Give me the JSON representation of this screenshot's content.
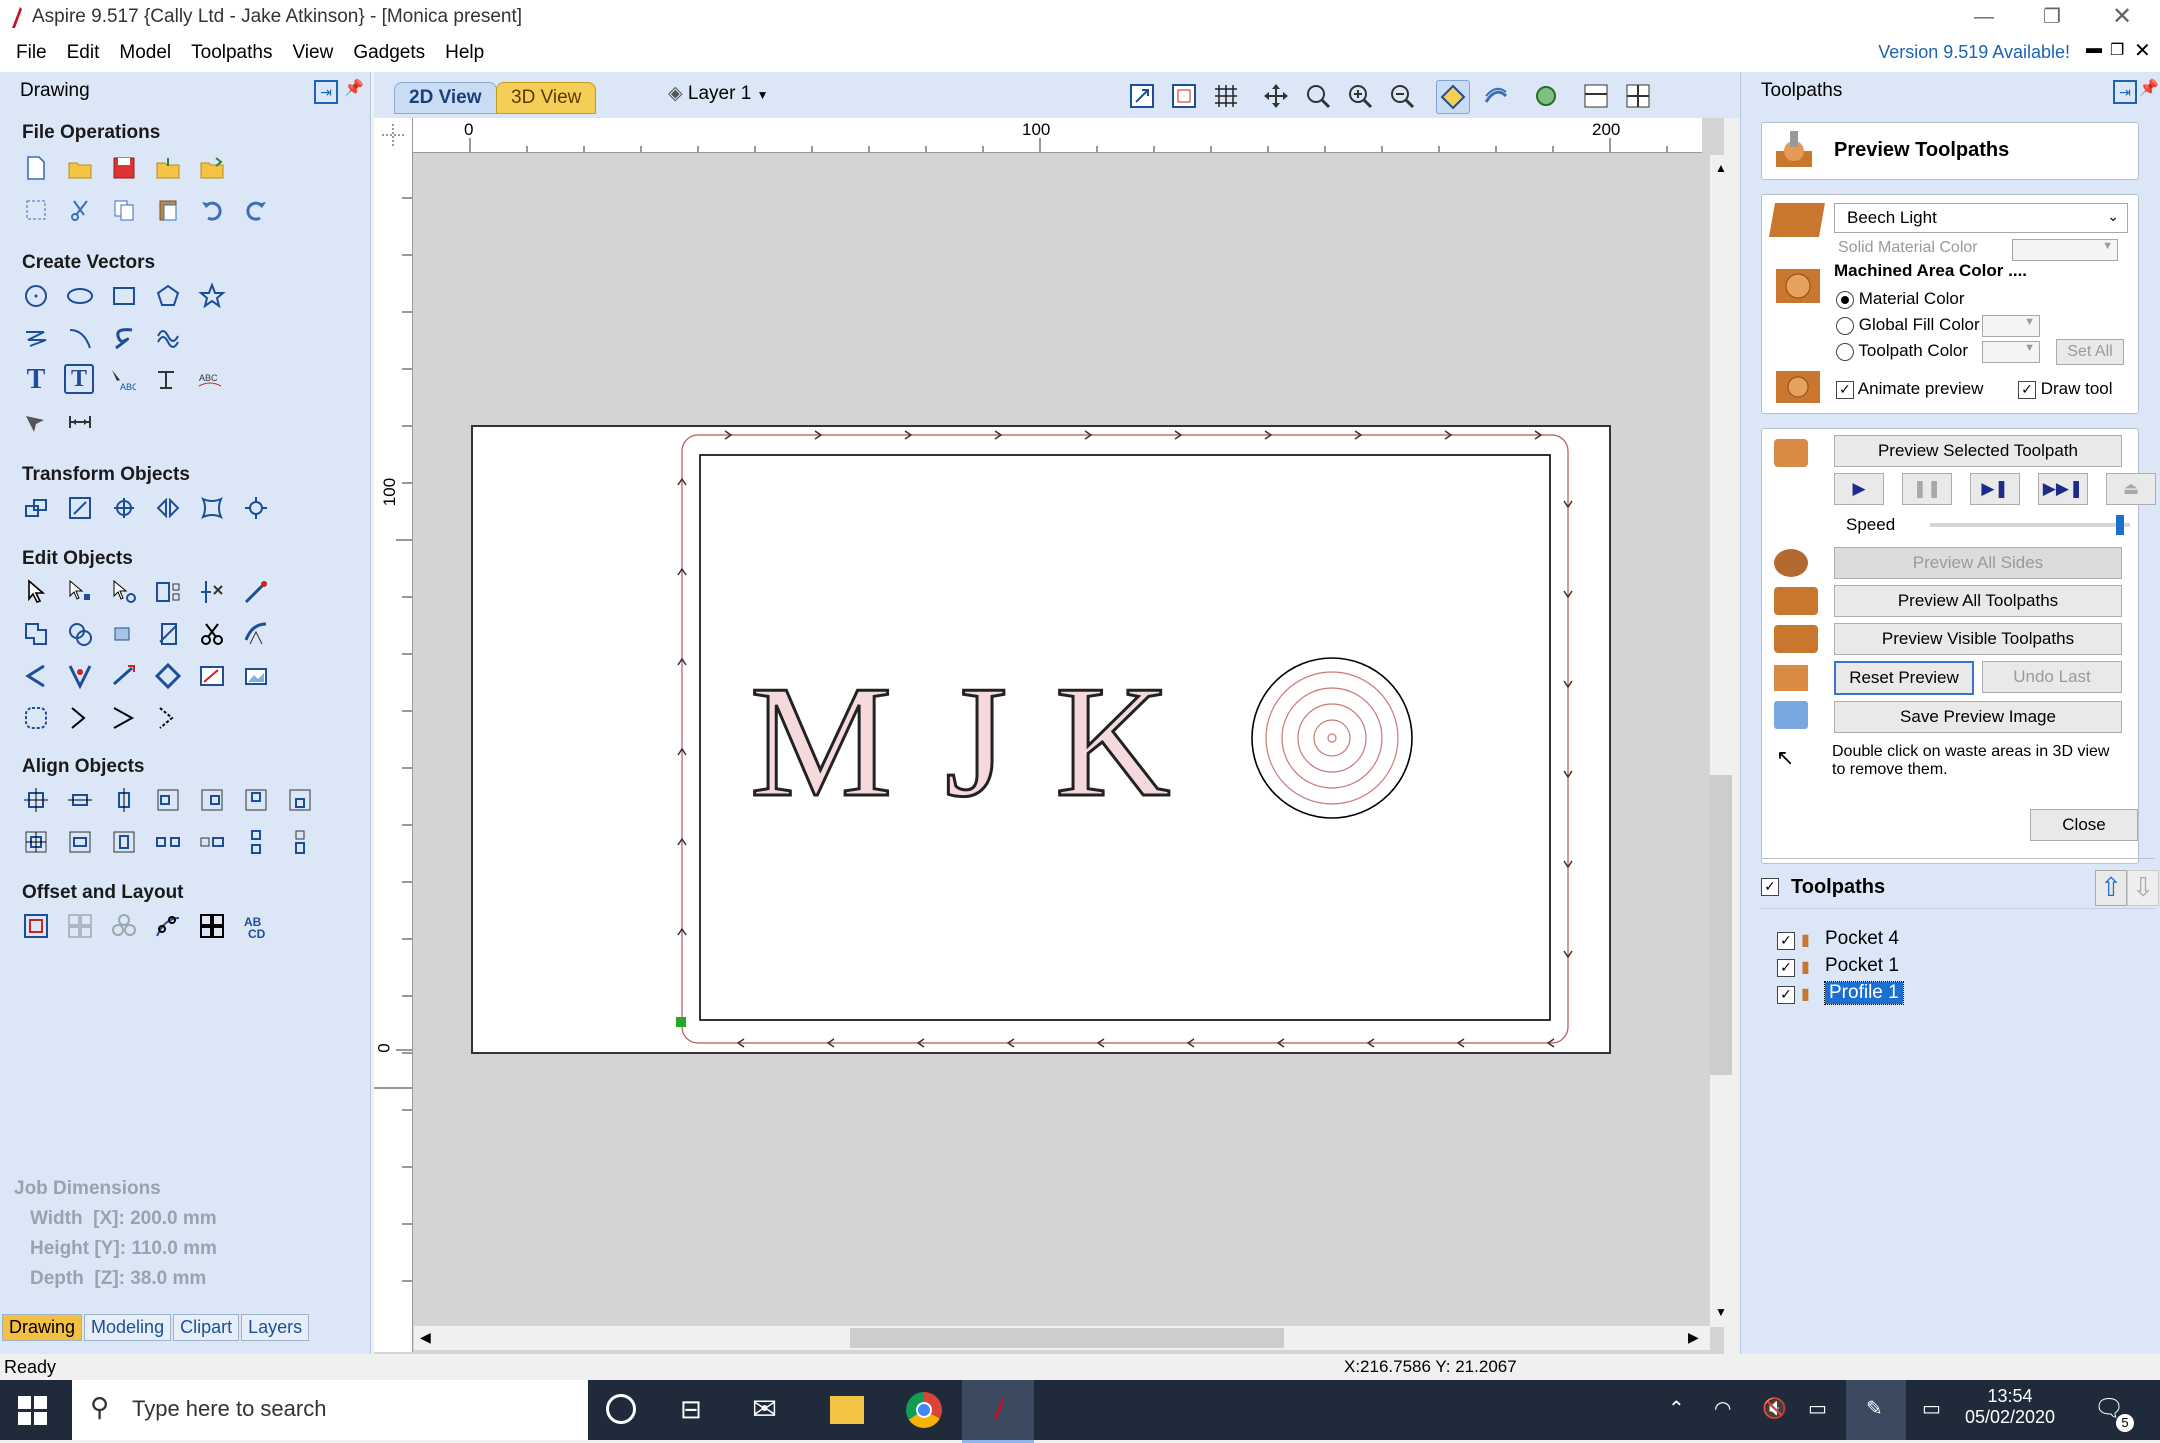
{
  "window": {
    "title": "Aspire 9.517 {Cally Ltd - Jake Atkinson} - [Monica present]",
    "version_notice": "Version 9.519 Available!"
  },
  "menu": [
    "File",
    "Edit",
    "Model",
    "Toolpaths",
    "View",
    "Gadgets",
    "Help"
  ],
  "left_panel": {
    "title": "Drawing",
    "sections": {
      "file_operations": "File Operations",
      "create_vectors": "Create Vectors",
      "transform_objects": "Transform Objects",
      "edit_objects": "Edit Objects",
      "align_objects": "Align Objects",
      "offset_layout": "Offset and Layout"
    },
    "job_dimensions": {
      "title": "Job Dimensions",
      "width": "Width  [X]: 200.0 mm",
      "height": "Height [Y]: 110.0 mm",
      "depth": "Depth  [Z]: 38.0 mm"
    },
    "tabs": [
      "Drawing",
      "Modeling",
      "Clipart",
      "Layers"
    ]
  },
  "view": {
    "tab_2d": "2D View",
    "tab_3d": "3D View",
    "layer": "Layer 1",
    "ruler_top": [
      "0",
      "100",
      "200"
    ],
    "ruler_left": [
      "100",
      "0"
    ],
    "letters": [
      "M",
      "J",
      "K"
    ]
  },
  "right_panel": {
    "title": "Toolpaths",
    "preview_title": "Preview Toolpaths",
    "material": "Beech Light",
    "solid_material_color": "Solid Material Color",
    "machined_area_color": "Machined Area Color ....",
    "material_color": "Material Color",
    "global_fill_color": "Global Fill Color",
    "toolpath_color": "Toolpath Color",
    "set_all": "Set All",
    "animate_preview": "Animate preview",
    "draw_tool": "Draw tool",
    "preview_selected": "Preview Selected Toolpath",
    "speed": "Speed",
    "speed_level": 0.97,
    "preview_all_sides": "Preview All Sides",
    "preview_all_toolpaths": "Preview All Toolpaths",
    "preview_visible_toolpaths": "Preview Visible Toolpaths",
    "reset_preview": "Reset Preview",
    "undo_last": "Undo Last",
    "save_preview_image": "Save Preview Image",
    "hint_line1": "Double click on waste areas in 3D view",
    "hint_line2": "to remove them.",
    "close": "Close",
    "toolpaths_list_title": "Toolpaths",
    "toolpaths": [
      "Pocket 4",
      "Pocket 1",
      "Profile 1"
    ]
  },
  "status": {
    "left": "Ready",
    "coords": "X:216.7586 Y: 21.2067"
  },
  "taskbar": {
    "search_placeholder": "Type here to search",
    "time": "13:54",
    "date": "05/02/2020",
    "notifications": "5"
  }
}
